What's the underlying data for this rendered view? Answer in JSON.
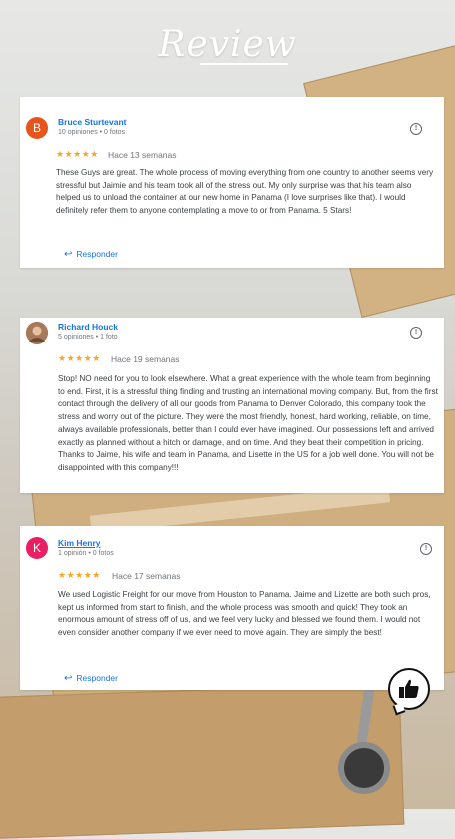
{
  "header": {
    "title": "Review"
  },
  "reviews": [
    {
      "avatar_letter": "B",
      "avatar_color": "#e8541e",
      "name": "Bruce Sturtevant",
      "meta": "10 opiniones • 0 fotos",
      "stars": "★★★★★",
      "ago": "Hace 13 semanas",
      "text": "These Guys are great. The whole process of moving everything from one country to another seems very stressful but Jaimie and his team took all of the stress out. My only surprise was that his team also helped us to unload the container at our new home in Panama (I love surprises like that). I would definitely refer them to anyone contemplating a move to or from Panama. 5 Stars!",
      "reply_label": "Responder"
    },
    {
      "avatar_letter": "",
      "avatar_color": "#8a5a3c",
      "name": "Richard Houck",
      "meta": "5 opiniones • 1 foto",
      "stars": "★★★★★",
      "ago": "Hace 19 semanas",
      "text": "Stop! NO need for you to look elsewhere. What a great experience with the whole team from beginning to end. First, it is a stressful thing finding and trusting an international moving company. But, from the first contact through the delivery of all our goods from Panama to Denver Colorado, this company took the stress and worry out of the picture. They were the most friendly, honest, hard working, reliable, on time, always available professionals, better than I could ever have imagined. Our possessions left and arrived exactly as planned without a hitch or damage, and on time. And they beat their competition in pricing. Thanks to Jaime, his wife and team in Panama, and Lisette in the US for a job well done. You will not be disappointed with this company!!!"
    },
    {
      "avatar_letter": "K",
      "avatar_color": "#e91e63",
      "name": "Kim Henry",
      "meta": "1 opinión • 0 fotos",
      "stars": "★★★★★",
      "ago": "Hace 17 semanas",
      "text": "We used Logistic Freight for our move from Houston to Panama. Jaime and Lizette are both such pros, kept us informed from start to finish, and the whole process was smooth and quick! They took an enormous amount of stress off of us, and we feel very lucky and blessed we found them. I would not even consider another company if we ever need to move again. They are simply the best!",
      "reply_label": "Responder"
    }
  ],
  "icons": {
    "flag": "report-flag-icon",
    "reply": "reply-arrow-icon",
    "thumb": "thumbs-up-icon"
  }
}
